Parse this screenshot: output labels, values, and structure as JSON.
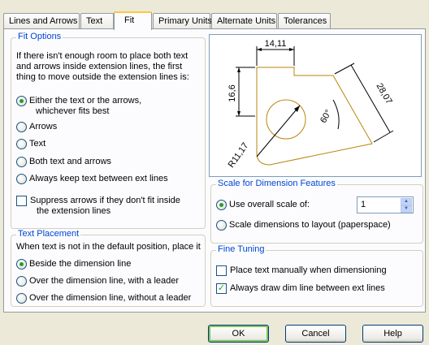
{
  "tabs": [
    {
      "label": "Lines and Arrows",
      "active": false
    },
    {
      "label": "Text",
      "active": false
    },
    {
      "label": "Fit",
      "active": true
    },
    {
      "label": "Primary Units",
      "active": false
    },
    {
      "label": "Alternate Units",
      "active": false
    },
    {
      "label": "Tolerances",
      "active": false
    }
  ],
  "fit_options": {
    "title": "Fit Options",
    "intro_lines": [
      "If there isn't enough room to place both text",
      "and arrows inside extension lines, the first",
      "thing to move outside the extension lines is:"
    ],
    "options": [
      {
        "label": "Either the text or the arrows,",
        "label2": "whichever fits best",
        "selected": true
      },
      {
        "label": "Arrows",
        "selected": false
      },
      {
        "label": "Text",
        "selected": false
      },
      {
        "label": "Both text and arrows",
        "selected": false
      },
      {
        "label": "Always keep text between ext lines",
        "selected": false
      }
    ],
    "suppress": {
      "label": "Suppress arrows if they don't fit inside",
      "label2": "the extension lines",
      "checked": false
    }
  },
  "text_placement": {
    "title": "Text Placement",
    "intro": "When text is not in the default position, place it",
    "options": [
      {
        "label": "Beside the dimension line",
        "selected": true
      },
      {
        "label": "Over the dimension line, with a leader",
        "selected": false
      },
      {
        "label": "Over the dimension line, without a leader",
        "selected": false
      }
    ]
  },
  "preview": {
    "dim_top": "14,11",
    "dim_left": "16,6",
    "dim_right": "28,07",
    "angle": "60°",
    "radius": "R11,17",
    "colors": {
      "outline": "#b8860b",
      "dim": "#000000"
    }
  },
  "scale": {
    "title": "Scale for Dimension Features",
    "overall_label": "Use overall scale of:",
    "overall_selected": true,
    "overall_value": "1",
    "layout_label": "Scale dimensions to layout (paperspace)",
    "layout_selected": false
  },
  "fine_tuning": {
    "title": "Fine Tuning",
    "manual_label": "Place text manually when dimensioning",
    "manual_checked": false,
    "always_label": "Always draw dim line between ext lines",
    "always_checked": true
  },
  "buttons": {
    "ok": "OK",
    "cancel": "Cancel",
    "help": "Help"
  },
  "colors": {
    "accent": "#0046d5",
    "tab_highlight": "#ffc83c",
    "check_green": "#21a121"
  }
}
